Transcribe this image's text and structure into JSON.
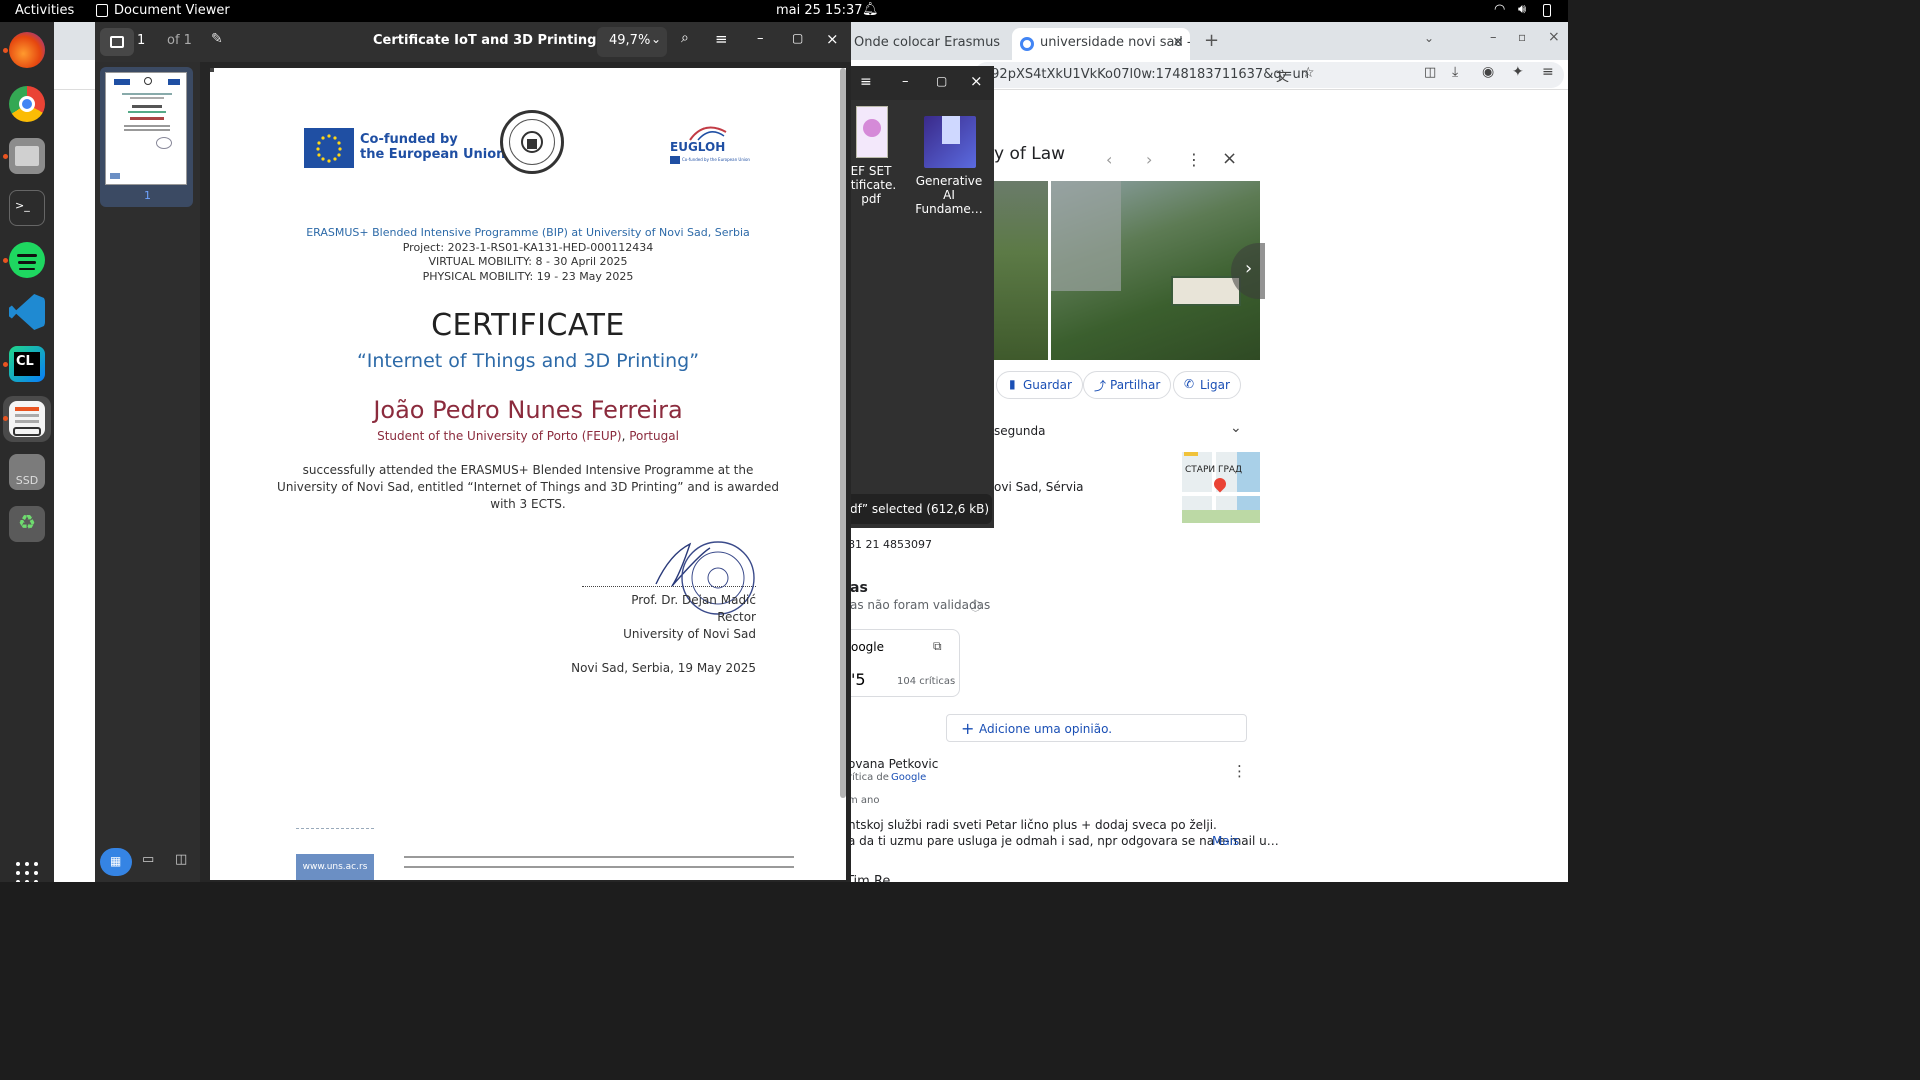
{
  "topbar": {
    "activities": "Activities",
    "app_name": "Document Viewer",
    "datetime": "mai 25  15:37"
  },
  "docviewer": {
    "page_current": "1",
    "page_of": "of 1",
    "title": "Certificate IoT and 3D Printing.pdf",
    "zoom": "49,7%",
    "thumb_label": "1"
  },
  "certificate": {
    "logo_eu": "Co-funded by\nthe European Union",
    "logo_eu_line1": "Co-funded by",
    "logo_eu_line2": "the European Union",
    "logo_eugloh": "EUGLOH",
    "logo_eugloh_sub": "Co-funded by the European Union",
    "programme": "ERASMUS+ Blended Intensive Programme (BIP) at University of Novi Sad, Serbia",
    "project": "Project: 2023-1-RS01-KA131-HED-000112434",
    "virtual": "VIRTUAL MOBILITY: 8 - 30 April 2025",
    "physical": "PHYSICAL MOBILITY: 19 - 23 May 2025",
    "heading": "CERTIFICATE",
    "course": "“Internet of Things and 3D Printing”",
    "name": "João Pedro Nunes Ferreira",
    "student_prefix": "Student of the ",
    "student_uni": "University of Porto (FEUP)",
    "student_sep": ", ",
    "student_country": "Portugal",
    "body_1": "successfully attended the ERASMUS+ Blended Intensive Programme at the",
    "body_2": "University of Novi Sad, entitled “Internet of Things and 3D Printing” and is awarded",
    "body_3": "with 3 ECTS.",
    "signer": "Prof. Dr. Dejan Madić",
    "signer_role": "Rector",
    "signer_org": "University of Novi Sad",
    "place_date": "Novi Sad, Serbia, 19 May 2025",
    "footer_site": "www.uns.ac.rs"
  },
  "browser": {
    "tab1": "Onde colocar Erasmus no",
    "tab2": "universidade novi sad - Pe",
    "url": "c92pXS4tXkU1VkKo07l0w:1748183711637&q=un"
  },
  "files": {
    "item1": "EF SET\nrtificate.\npdf",
    "item1_l1": "EF SET",
    "item1_l2": "rtificate.",
    "item1_l3": "pdf",
    "item2_l1": "Generative",
    "item2_l2": "AI",
    "item2_l3": "Fundame…",
    "selected": "df” selected  (612,6 kB)"
  },
  "maps": {
    "title": "y of Law",
    "guardar": "Guardar",
    "partilhar": "Partilhar",
    "ligar": "Ligar",
    "hours": "segunda",
    "address": "ovi Sad, Sérvia",
    "map_label": "СТАРИ ГРАД",
    "phone": "81 21 4853097",
    "reviews_title": "as",
    "reviews_note": "as não foram validadas",
    "google": "oogle",
    "rating": "'5",
    "reviews_count": "104 críticas",
    "add_review": "Adicione uma opinião.",
    "reviewer": "ovana Petkovic",
    "reviewer_sub": "rítica de",
    "reviewer_google": "Google",
    "review_time": "m ano",
    "review_text_1": "ntskoj službi radi sveti Petar lično plus + dodaj sveca po želji.",
    "review_text_2": "a da ti uzmu pare usluga je odmah i sad, npr odgovara se na e-mail u…",
    "review_more": "Mais",
    "bottom": "Tim Re"
  },
  "colors": {
    "eu_blue": "#1f4fa3",
    "cert_blue": "#2d6aa8",
    "cert_maroon": "#8b2b3d",
    "ubuntu_orange": "#e95420"
  }
}
